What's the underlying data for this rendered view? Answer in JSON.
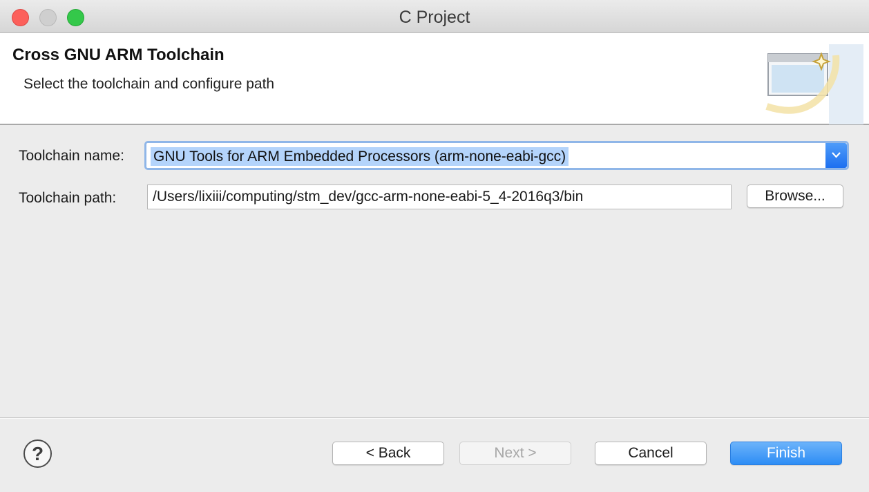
{
  "window": {
    "title": "C Project"
  },
  "banner": {
    "title": "Cross GNU ARM Toolchain",
    "subtitle": "Select the toolchain and configure path",
    "graphic_icon": "wizard-graphic-icon"
  },
  "form": {
    "toolchain_label": "Toolchain name:",
    "toolchain_value": "GNU Tools for ARM Embedded Processors (arm-none-eabi-gcc)",
    "path_label": "Toolchain path:",
    "path_value": "/Users/lixiii/computing/stm_dev/gcc-arm-none-eabi-5_4-2016q3/bin",
    "browse_label": "Browse..."
  },
  "footer": {
    "help_symbol": "?",
    "back_label": "< Back",
    "next_label": "Next >",
    "next_enabled": false,
    "cancel_label": "Cancel",
    "finish_label": "Finish"
  },
  "colors": {
    "accent": "#2d8df5",
    "selection": "#b4d4fb",
    "close": "#fc605b",
    "maximize": "#34c84a"
  }
}
